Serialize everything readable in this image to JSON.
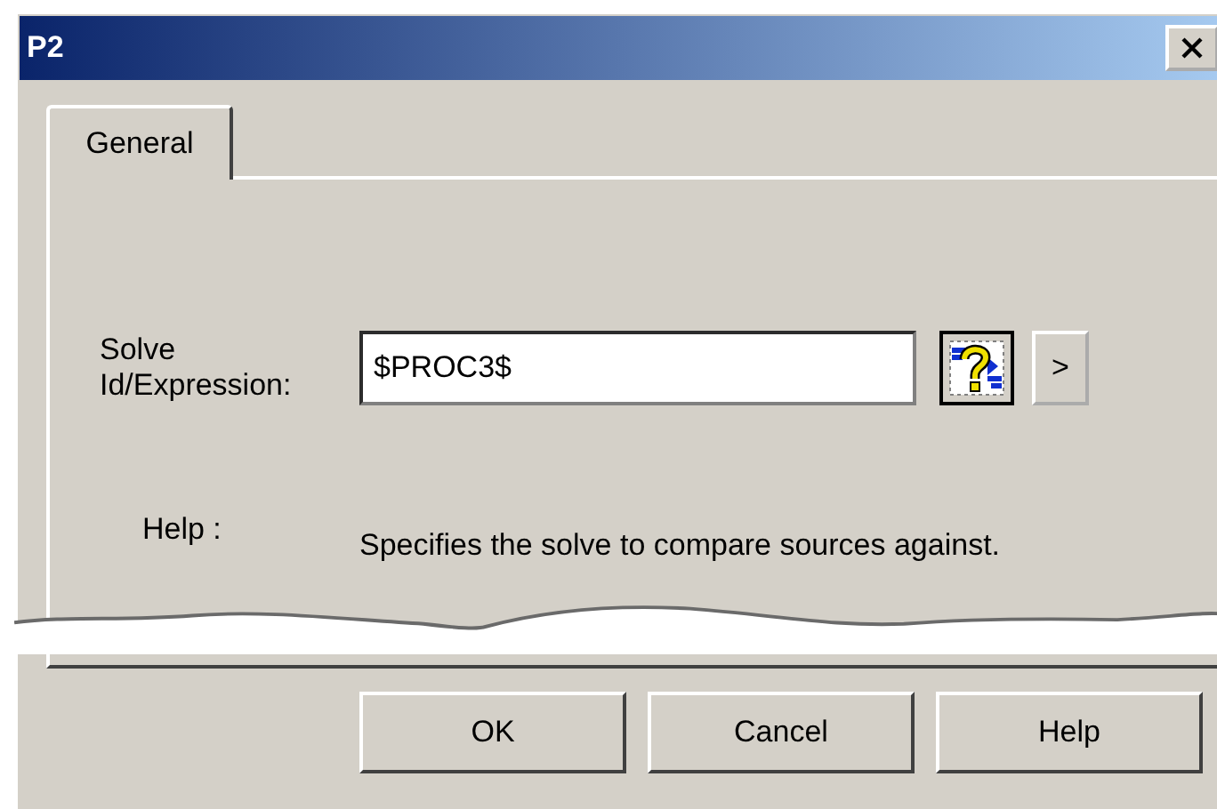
{
  "window": {
    "title": "P2"
  },
  "tabs": [
    {
      "label": "General",
      "selected": true
    }
  ],
  "solve_field": {
    "label": "Solve Id/Expression:",
    "value": "$PROC3$",
    "more_button": ">"
  },
  "help": {
    "label": "Help :",
    "text": "Specifies the solve to compare sources against."
  },
  "buttons": [
    "OK",
    "Cancel",
    "Help"
  ]
}
